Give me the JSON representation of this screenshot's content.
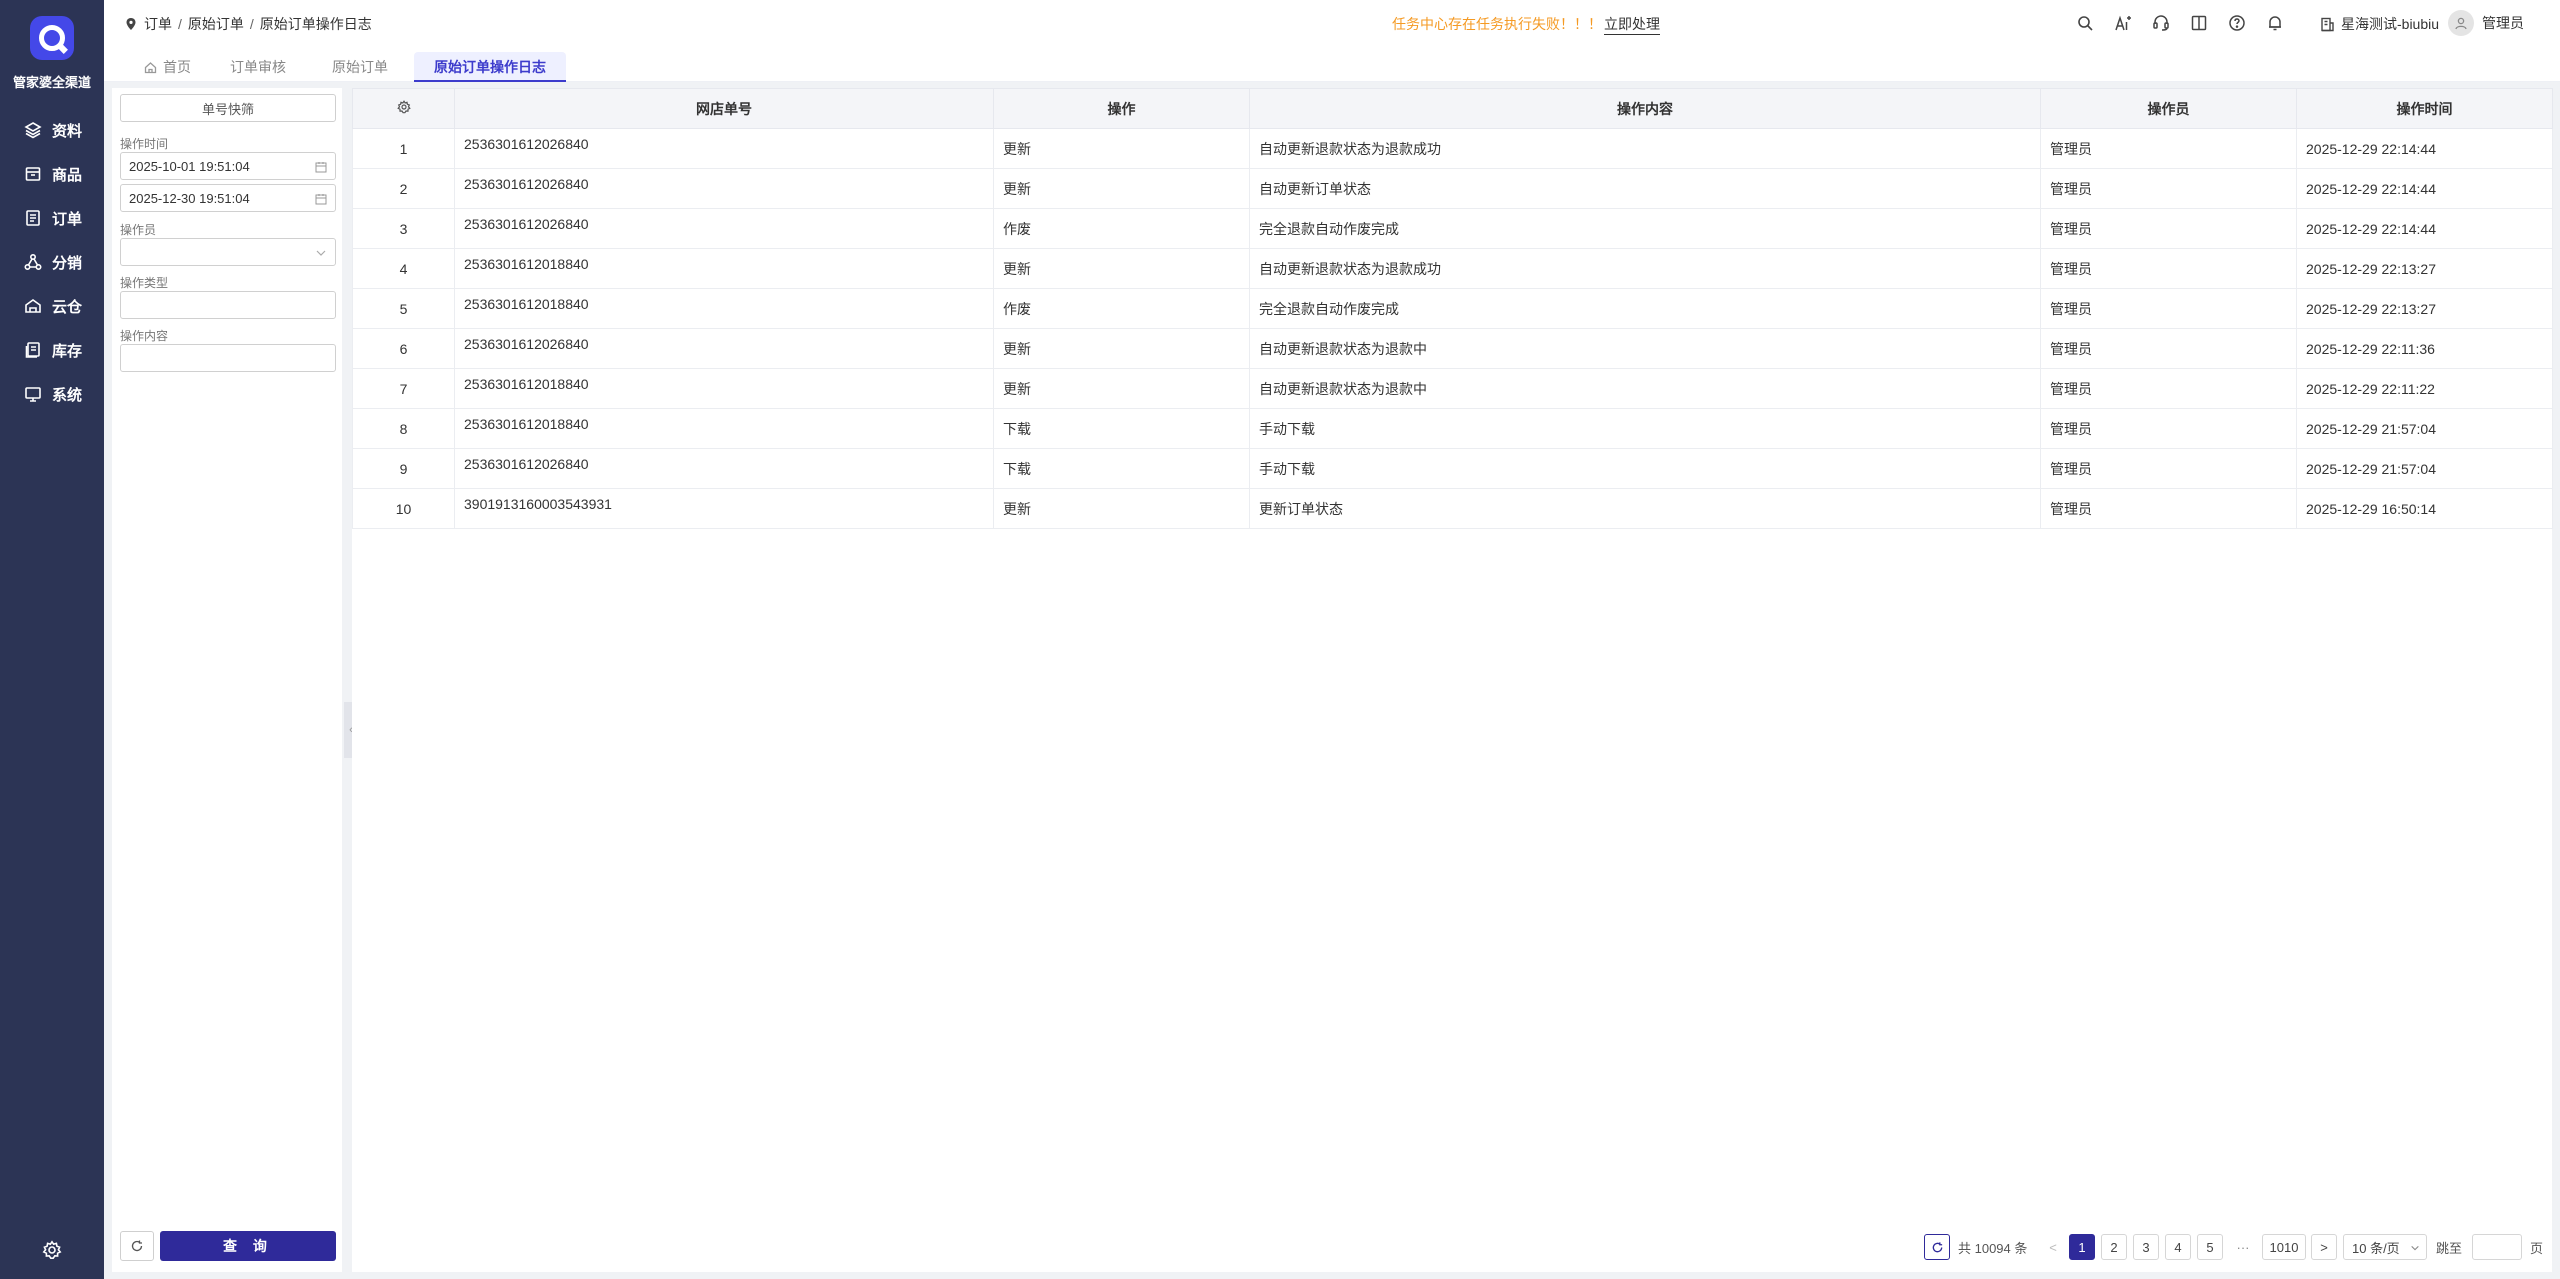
{
  "brand": {
    "name": "管家婆全渠道"
  },
  "nav": {
    "items": [
      {
        "label": "资料",
        "icon": "layers-icon"
      },
      {
        "label": "商品",
        "icon": "package-icon"
      },
      {
        "label": "订单",
        "icon": "order-icon"
      },
      {
        "label": "分销",
        "icon": "distribution-icon"
      },
      {
        "label": "云仓",
        "icon": "cloud-warehouse-icon"
      },
      {
        "label": "库存",
        "icon": "inventory-icon"
      },
      {
        "label": "系统",
        "icon": "monitor-icon"
      }
    ]
  },
  "topbar": {
    "breadcrumb": [
      "订单",
      "原始订单",
      "原始订单操作日志"
    ],
    "alert_text": "任务中心存在任务执行失败！！！",
    "alert_action": "立即处理",
    "shop_name": "星海测试-biubiu",
    "user_name": "管理员",
    "accent_color": "#f59a23"
  },
  "tabs": [
    {
      "label": "首页",
      "icon": "home-icon"
    },
    {
      "label": "订单审核"
    },
    {
      "label": "原始订单"
    },
    {
      "label": "原始订单操作日志",
      "active": true
    }
  ],
  "filter": {
    "quick_search_label": "单号快筛",
    "time_label": "操作时间",
    "time_start": "2025-10-01 19:51:04",
    "time_end": "2025-12-30 19:51:04",
    "operator_label": "操作员",
    "operator_value": "",
    "op_type_label": "操作类型",
    "op_type_value": "",
    "op_content_label": "操作内容",
    "op_content_value": "",
    "query_label": "查 询"
  },
  "table": {
    "columns": [
      "网店单号",
      "操作",
      "操作内容",
      "操作员",
      "操作时间"
    ],
    "rows": [
      {
        "idx": "1",
        "order": "2536301612026840",
        "op": "更新",
        "content": "自动更新退款状态为退款成功",
        "operator": "管理员",
        "time": "2025-12-29 22:14:44"
      },
      {
        "idx": "2",
        "order": "2536301612026840",
        "op": "更新",
        "content": "自动更新订单状态",
        "operator": "管理员",
        "time": "2025-12-29 22:14:44"
      },
      {
        "idx": "3",
        "order": "2536301612026840",
        "op": "作废",
        "content": "完全退款自动作废完成",
        "operator": "管理员",
        "time": "2025-12-29 22:14:44"
      },
      {
        "idx": "4",
        "order": "2536301612018840",
        "op": "更新",
        "content": "自动更新退款状态为退款成功",
        "operator": "管理员",
        "time": "2025-12-29 22:13:27"
      },
      {
        "idx": "5",
        "order": "2536301612018840",
        "op": "作废",
        "content": "完全退款自动作废完成",
        "operator": "管理员",
        "time": "2025-12-29 22:13:27"
      },
      {
        "idx": "6",
        "order": "2536301612026840",
        "op": "更新",
        "content": "自动更新退款状态为退款中",
        "operator": "管理员",
        "time": "2025-12-29 22:11:36"
      },
      {
        "idx": "7",
        "order": "2536301612018840",
        "op": "更新",
        "content": "自动更新退款状态为退款中",
        "operator": "管理员",
        "time": "2025-12-29 22:11:22"
      },
      {
        "idx": "8",
        "order": "2536301612018840",
        "op": "下载",
        "content": "手动下载",
        "operator": "管理员",
        "time": "2025-12-29 21:57:04"
      },
      {
        "idx": "9",
        "order": "2536301612026840",
        "op": "下载",
        "content": "手动下载",
        "operator": "管理员",
        "time": "2025-12-29 21:57:04"
      },
      {
        "idx": "10",
        "order": "3901913160003543931",
        "op": "更新",
        "content": "更新订单状态",
        "operator": "管理员",
        "time": "2025-12-29 16:50:14"
      }
    ]
  },
  "pagination": {
    "total_text": "共 10094 条",
    "pages": [
      "1",
      "2",
      "3",
      "4",
      "5"
    ],
    "ellipsis": "···",
    "last_page": "1010",
    "page_size": "10 条/页",
    "jump_label": "跳至",
    "jump_value": "",
    "page_suffix": "页",
    "prev": "<",
    "next": ">"
  }
}
